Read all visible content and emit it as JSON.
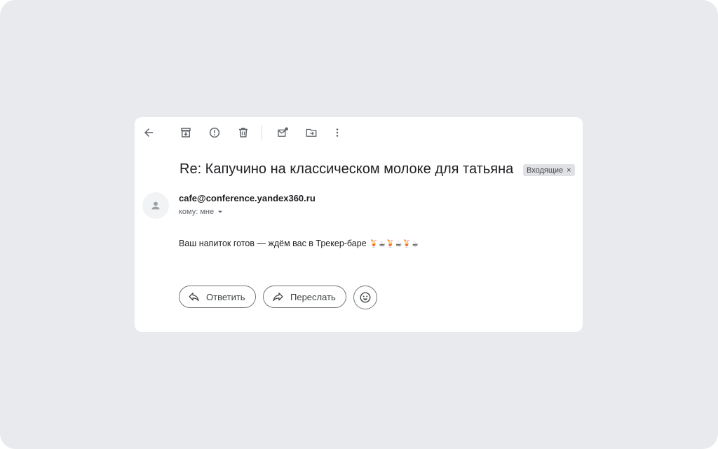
{
  "toolbar": {
    "back": "back-icon",
    "archive": "archive-icon",
    "spam": "report-spam-icon",
    "delete": "delete-icon",
    "unread": "mark-unread-icon",
    "move": "move-to-icon",
    "more": "more-vert-icon"
  },
  "message": {
    "subject": "Re: Капучино на классическом молоке для татьяна",
    "label": "Входящие",
    "label_remove": "×",
    "sender": "cafe@conference.yandex360.ru",
    "to": "кому: мне",
    "body": "Ваш напиток готов — ждём вас в Трекер-баре",
    "body_emojis": "🍹☕🍹☕🍹☕"
  },
  "actions": {
    "reply": "Ответить",
    "forward": "Переслать"
  },
  "colors": {
    "background": "#e9eaed",
    "card": "#ffffff",
    "icon": "#5f6368",
    "text": "#202124"
  }
}
